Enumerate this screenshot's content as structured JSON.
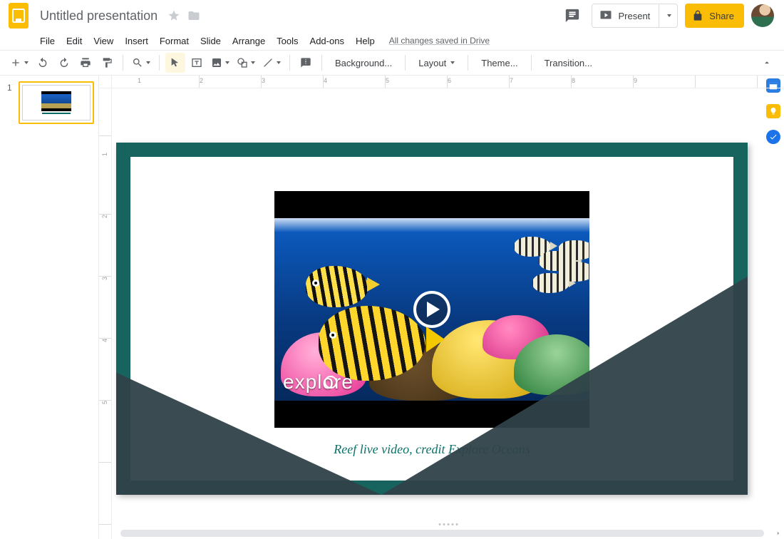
{
  "doc": {
    "title": "Untitled presentation",
    "save_status": "All changes saved in Drive"
  },
  "header": {
    "present_label": "Present",
    "share_label": "Share"
  },
  "menu": {
    "file": "File",
    "edit": "Edit",
    "view": "View",
    "insert": "Insert",
    "format": "Format",
    "slide": "Slide",
    "arrange": "Arrange",
    "tools": "Tools",
    "addons": "Add-ons",
    "help": "Help"
  },
  "toolbar": {
    "background": "Background...",
    "layout": "Layout",
    "theme": "Theme...",
    "transition": "Transition..."
  },
  "filmstrip": {
    "slides": [
      {
        "index": "1"
      }
    ]
  },
  "ruler": {
    "h": [
      "1",
      "2",
      "3",
      "4",
      "5",
      "6",
      "7",
      "8",
      "9"
    ],
    "v": [
      "1",
      "2",
      "3",
      "4",
      "5"
    ]
  },
  "slide": {
    "video_watermark": "expl  re",
    "caption": "Reef live video, credit Explore Oceans"
  }
}
